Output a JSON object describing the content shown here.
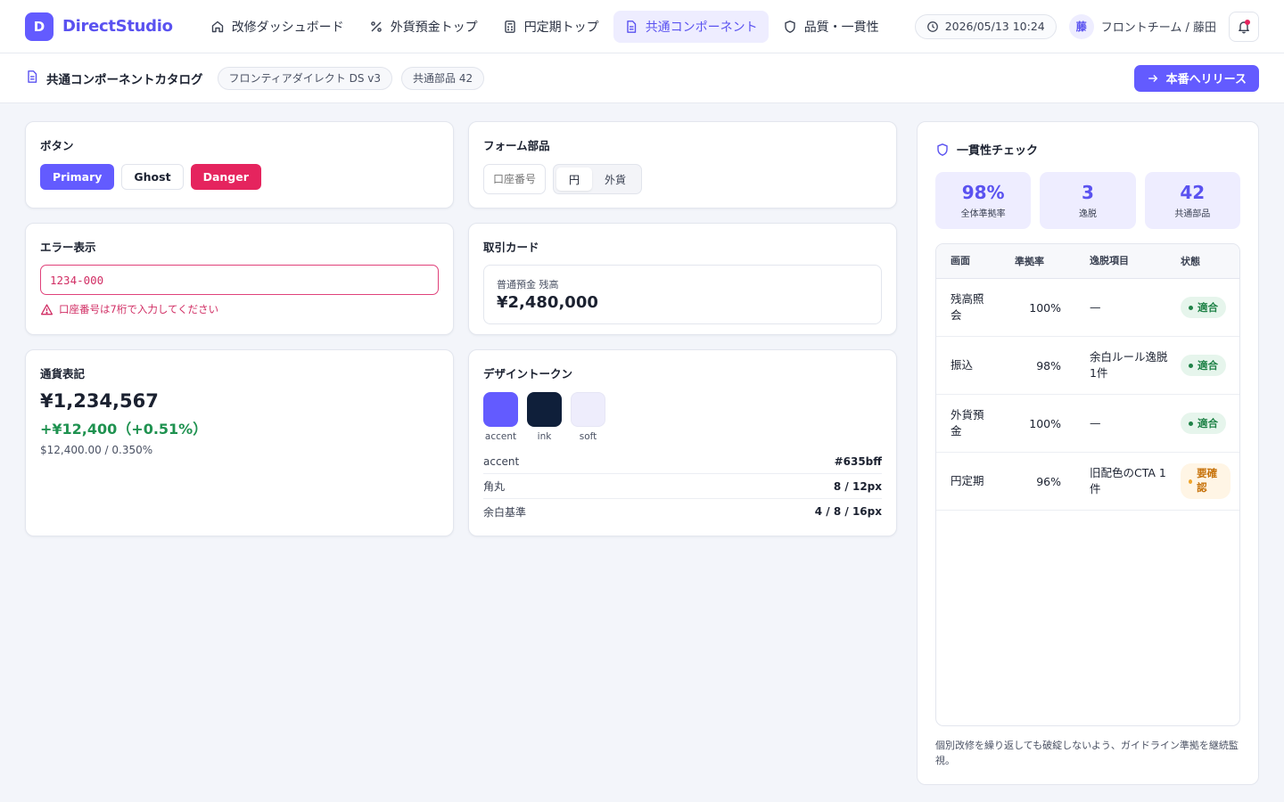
{
  "app": {
    "logo_letter": "D",
    "name": "DirectStudio"
  },
  "nav": [
    {
      "label": "改修ダッシュボード",
      "icon": "home-icon",
      "active": false
    },
    {
      "label": "外貨預金トップ",
      "icon": "percent-icon",
      "active": false
    },
    {
      "label": "円定期トップ",
      "icon": "calculator-icon",
      "active": false
    },
    {
      "label": "共通コンポーネント",
      "icon": "document-icon",
      "active": true
    },
    {
      "label": "品質・一貫性",
      "icon": "shield-icon",
      "active": false
    }
  ],
  "header": {
    "datetime": "2026/05/13 10:24",
    "avatar": "藤",
    "user": "フロントチーム / 藤田"
  },
  "subheader": {
    "title": "共通コンポーネントカタログ",
    "chips": [
      "フロンティアダイレクト DS v3",
      "共通部品 42"
    ],
    "release_label": "本番へリリース"
  },
  "buttons_card": {
    "title": "ボタン",
    "primary": "Primary",
    "ghost": "Ghost",
    "danger": "Danger"
  },
  "form_card": {
    "title": "フォーム部品",
    "input_placeholder": "口座番号",
    "segments": [
      "円",
      "外貨"
    ],
    "selected": "円"
  },
  "error_card": {
    "title": "エラー表示",
    "value": "1234-000",
    "message": "口座番号は7桁で入力してください"
  },
  "tx_card": {
    "title": "取引カード",
    "label": "普通預金 残高",
    "amount": "¥2,480,000"
  },
  "currency_card": {
    "title": "通貨表記",
    "main": "¥1,234,567",
    "delta": "+¥12,400（+0.51%）",
    "sub": "$12,400.00 / 0.350%"
  },
  "tokens_card": {
    "title": "デザイントークン",
    "swatches": [
      {
        "label": "accent",
        "color": "#635bff"
      },
      {
        "label": "ink",
        "color": "#0f1f3a"
      },
      {
        "label": "soft",
        "color": "#eeedfc"
      }
    ],
    "rows": [
      {
        "key": "accent",
        "value": "#635bff"
      },
      {
        "key": "角丸",
        "value": "8 / 12px"
      },
      {
        "key": "余白基準",
        "value": "4 / 8 / 16px"
      }
    ]
  },
  "consistency": {
    "title": "一貫性チェック",
    "stats": [
      {
        "value": "98%",
        "label": "全体準拠率"
      },
      {
        "value": "3",
        "label": "逸脱"
      },
      {
        "value": "42",
        "label": "共通部品"
      }
    ],
    "columns": [
      "画面",
      "準拠率",
      "逸脱項目",
      "状態"
    ],
    "rows": [
      {
        "screen": "残高照会",
        "rate": "100%",
        "issue": "—",
        "status": "適合",
        "kind": "ok"
      },
      {
        "screen": "振込",
        "rate": "98%",
        "issue": "余白ルール逸脱 1件",
        "status": "適合",
        "kind": "ok"
      },
      {
        "screen": "外貨預金",
        "rate": "100%",
        "issue": "—",
        "status": "適合",
        "kind": "ok"
      },
      {
        "screen": "円定期",
        "rate": "96%",
        "issue": "旧配色のCTA 1件",
        "status": "要確認",
        "kind": "warn"
      }
    ],
    "note": "個別改修を繰り返しても破綻しないよう、ガイドライン準拠を継続監視。"
  }
}
